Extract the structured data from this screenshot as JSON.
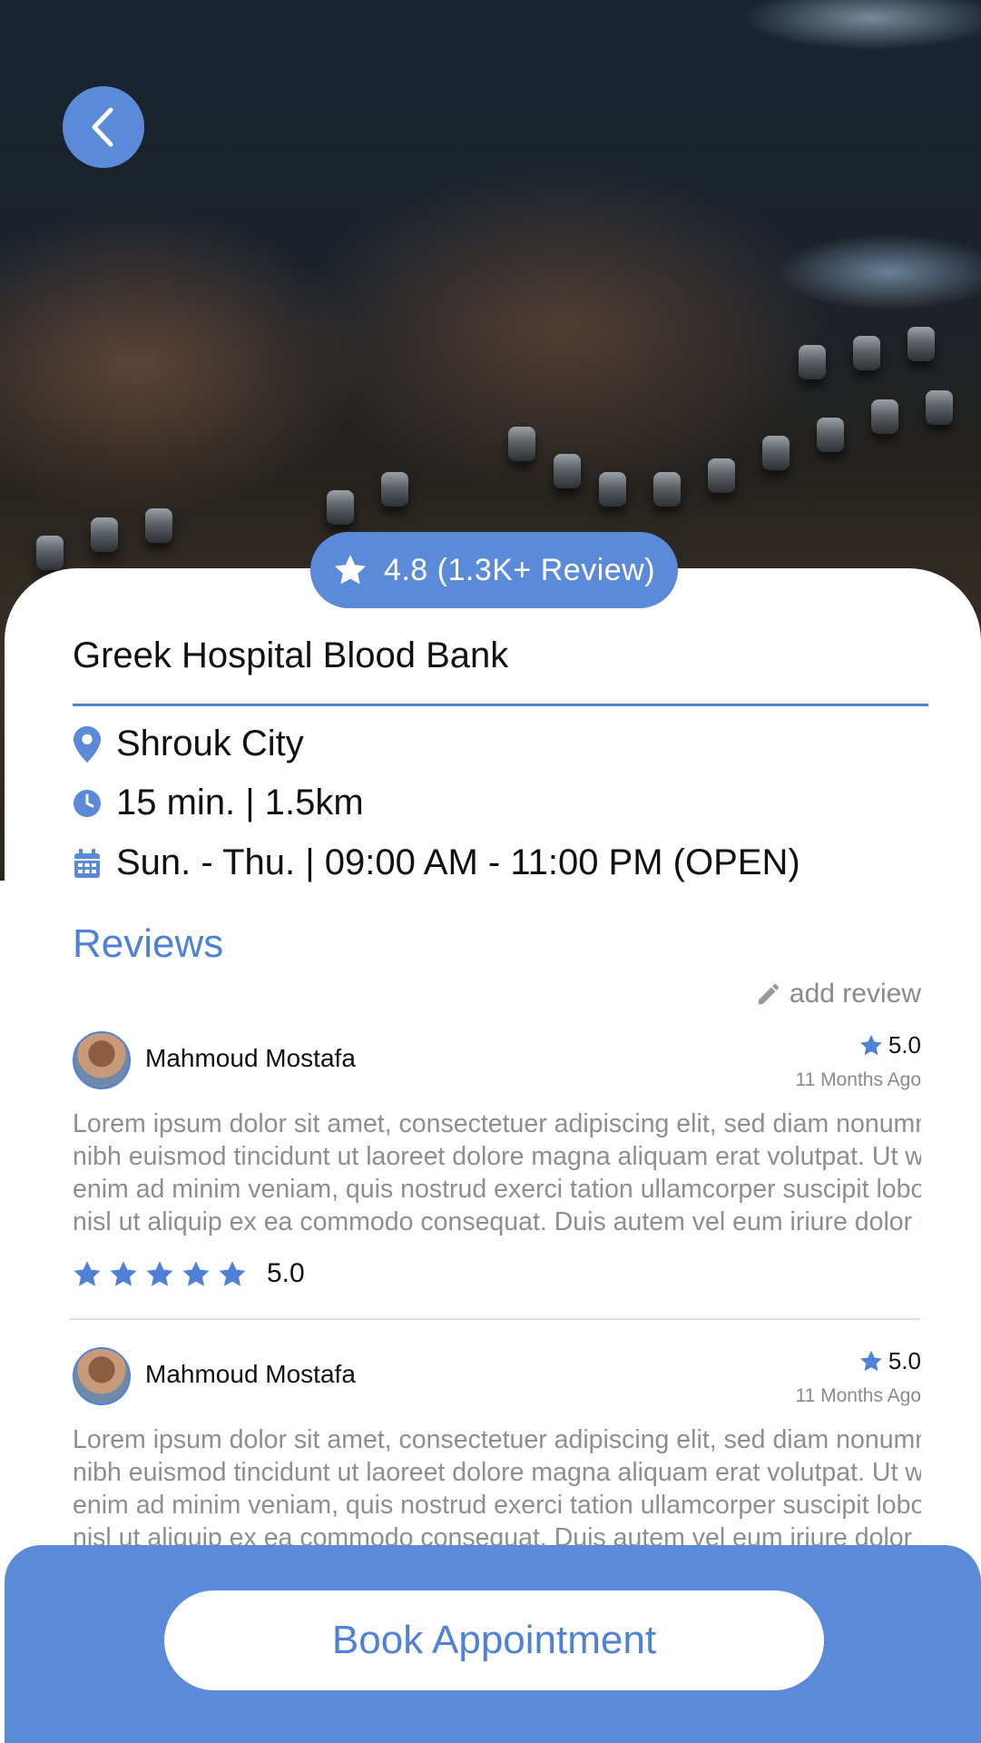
{
  "place": {
    "rating_value": "4.8",
    "rating_count": "(1.3K+ Review)",
    "name": "Greek Hospital Blood Bank",
    "location": "Shrouk City",
    "distance": "15 min. | 1.5km",
    "hours": "Sun. - Thu. | 09:00 AM - 11:00 PM (OPEN)"
  },
  "reviews_section": {
    "heading": "Reviews",
    "add_review_label": "add review"
  },
  "reviews": [
    {
      "name": "Mahmoud Mostafa",
      "score": "5.0",
      "ago": "11 Months Ago",
      "lines": [
        "Lorem ipsum dolor sit amet, consectetuer adipiscing elit, sed diam nonummy",
        "nibh euismod tincidunt ut laoreet dolore magna aliquam erat volutpat. Ut wisi",
        "enim ad minim veniam, quis nostrud exerci tation ullamcorper suscipit lobortis",
        "nisl ut aliquip ex ea commodo consequat. Duis autem vel eum iriure dolor in hen-"
      ],
      "stars": 5,
      "stars_value": "5.0"
    },
    {
      "name": "Mahmoud Mostafa",
      "score": "5.0",
      "ago": "11 Months Ago",
      "lines": [
        "Lorem ipsum dolor sit amet, consectetuer adipiscing elit, sed diam nonummy",
        "nibh euismod tincidunt ut laoreet dolore magna aliquam erat volutpat. Ut wisi",
        "enim ad minim veniam, quis nostrud exerci tation ullamcorper suscipit lobortis",
        "nisl ut aliquip ex ea commodo consequat. Duis autem vel eum iriure dolor in hen-"
      ]
    }
  ],
  "actions": {
    "book_label": "Book Appointment"
  },
  "colors": {
    "accent": "#5a8ad8",
    "accent_text": "#4f82d6",
    "muted_text": "#8e8e8e"
  },
  "icons": {
    "back": "chevron-left-icon",
    "rating": "star-icon",
    "location": "map-pin-icon",
    "distance": "clock-icon",
    "hours": "calendar-icon",
    "add_review": "pencil-icon"
  }
}
